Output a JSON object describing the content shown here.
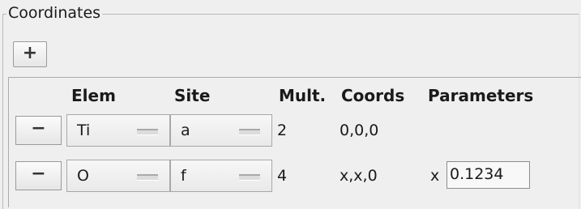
{
  "group": {
    "title": "Coordinates"
  },
  "add_button": {
    "label": "+"
  },
  "headers": {
    "elem": "Elem",
    "site": "Site",
    "mult": "Mult.",
    "coords": "Coords",
    "parameters": "Parameters"
  },
  "rows": [
    {
      "remove_label": "−",
      "elem": "Ti",
      "site": "a",
      "mult": "2",
      "coords": "0,0,0",
      "param_prefix": "",
      "param_value": ""
    },
    {
      "remove_label": "−",
      "elem": "O",
      "site": "f",
      "mult": "4",
      "coords": "x,x,0",
      "param_prefix": "x",
      "param_value": "0.1234"
    }
  ]
}
